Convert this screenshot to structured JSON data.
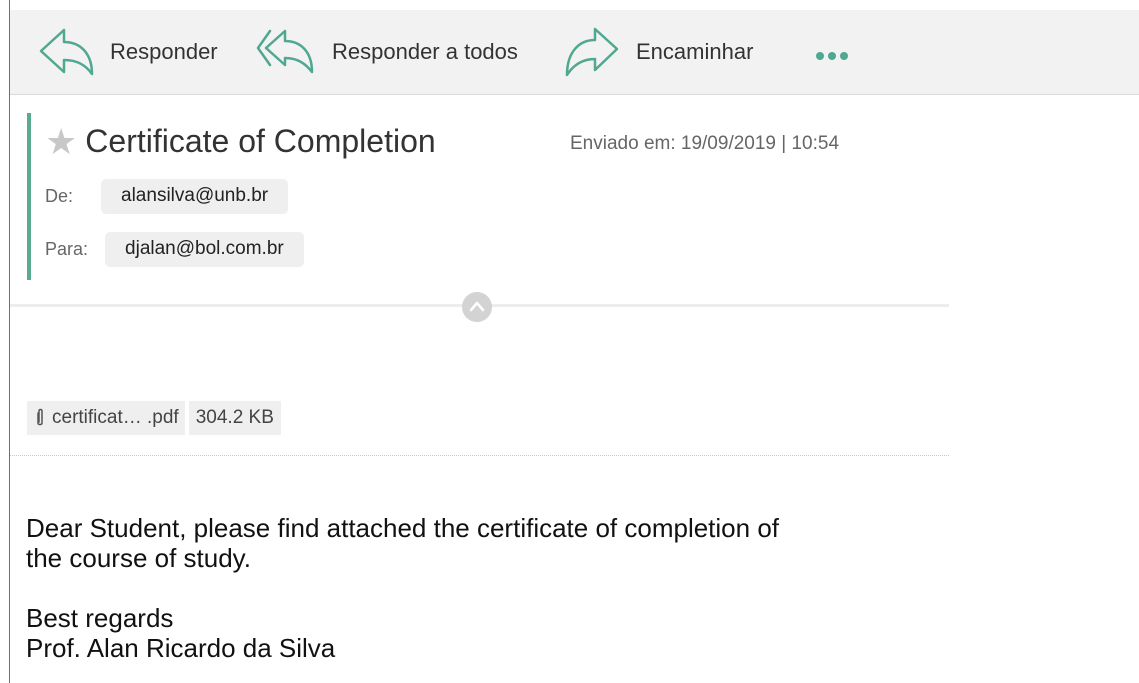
{
  "theme": {
    "accent": "#4fa88f",
    "accent_bar": "#5aaa91"
  },
  "toolbar": {
    "reply": {
      "label": "Responder",
      "icon": "reply-icon"
    },
    "reply_all": {
      "label": "Responder a todos",
      "icon": "reply-all-icon"
    },
    "forward": {
      "label": "Encaminhar",
      "icon": "forward-icon"
    },
    "more": {
      "icon": "more-options-icon"
    }
  },
  "message": {
    "subject": "Certificate of Completion",
    "star_icon": "star-icon",
    "sent": "Enviado em: 19/09/2019 | 10:54",
    "from": {
      "label": "De:",
      "address": "alansilva@unb.br"
    },
    "to": {
      "label": "Para:",
      "address": "djalan@bol.com.br"
    },
    "collapse_icon": "chevron-up-icon"
  },
  "attachment": {
    "icon": "paperclip-icon",
    "name": "certificat… .pdf",
    "size": "304.2 KB"
  },
  "body": {
    "line1": "Dear Student, please find attached the certificate of completion of",
    "line2": "the course of study.",
    "line3": "Best regards",
    "line4": "Prof. Alan Ricardo da Silva"
  }
}
